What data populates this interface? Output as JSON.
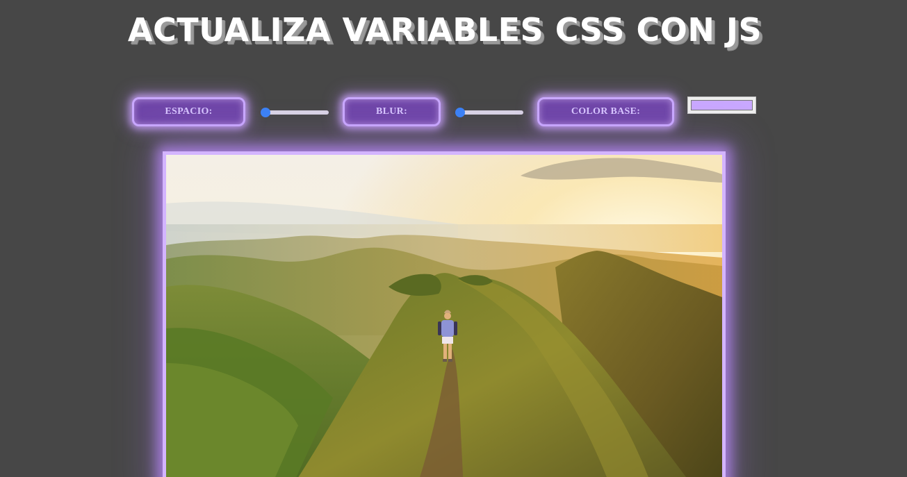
{
  "header": {
    "title": "ACTUALIZA VARIABLES CSS CON JS"
  },
  "controls": {
    "spacing": {
      "label": "ESPACIO:",
      "value_fraction": 0.0
    },
    "blur": {
      "label": "BLUR:",
      "value_fraction": 0.0
    },
    "base_color": {
      "label": "COLOR BASE:",
      "value": "#c9a8ff"
    }
  },
  "colors": {
    "background": "#474747",
    "accent": "#c9a8ff",
    "label_fill": "#6f46a8",
    "slider_thumb": "#3b82f6"
  },
  "image": {
    "subject": "hiker-on-mountain-ridge-at-sunset"
  }
}
